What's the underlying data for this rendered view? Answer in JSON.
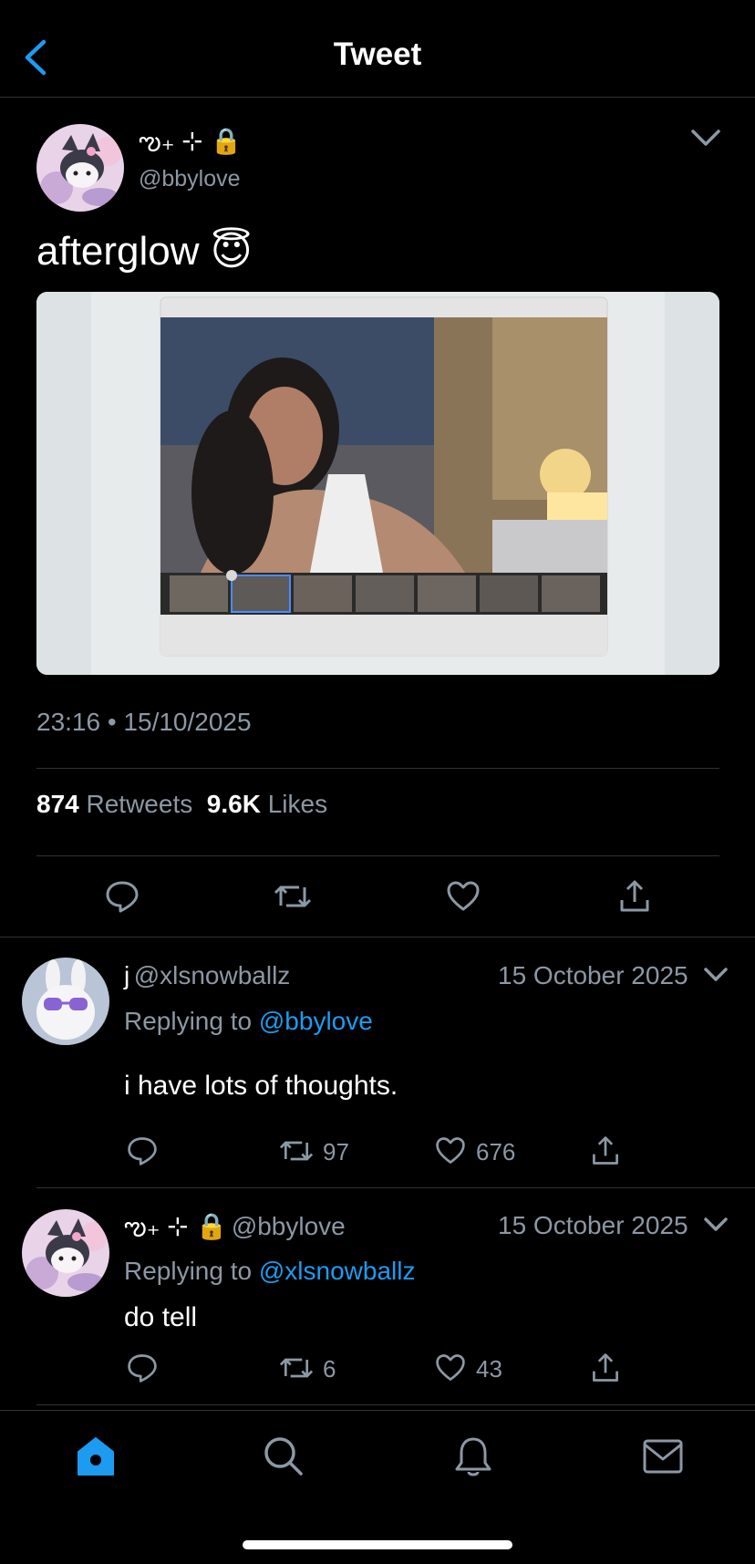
{
  "header": {
    "title": "Tweet"
  },
  "main_tweet": {
    "display_name": "ఌ₊ ⊹ 🔒",
    "handle": "@bbylove",
    "text": "afterglow 😇",
    "timestamp": "23:16 • 15/10/2025",
    "retweets_count": "874",
    "retweets_label": "Retweets",
    "likes_count": "9.6K",
    "likes_label": "Likes"
  },
  "replies": [
    {
      "display_name": "j",
      "handle": "@xlsnowballz",
      "date": "15 October 2025",
      "replying_prefix": "Replying to",
      "replying_to": "@bbylove",
      "text": "i have lots of thoughts.",
      "retweets": "97",
      "likes": "676"
    },
    {
      "display_name": "ఌ₊ ⊹ 🔒",
      "handle": "@bbylove",
      "date": "15 October 2025",
      "replying_prefix": "Replying to",
      "replying_to": "@xlsnowballz",
      "text": "do tell",
      "retweets": "6",
      "likes": "43"
    }
  ],
  "icons": {
    "back": "chevron-left-icon",
    "caret": "chevron-down-icon",
    "reply": "reply-icon",
    "retweet": "retweet-icon",
    "like": "heart-icon",
    "share": "share-icon",
    "tab_home": "home-icon",
    "tab_search": "search-icon",
    "tab_notifications": "bell-icon",
    "tab_messages": "mail-icon"
  },
  "colors": {
    "accent": "#1d9bf0",
    "muted": "#8b98a5",
    "background": "#000000"
  }
}
